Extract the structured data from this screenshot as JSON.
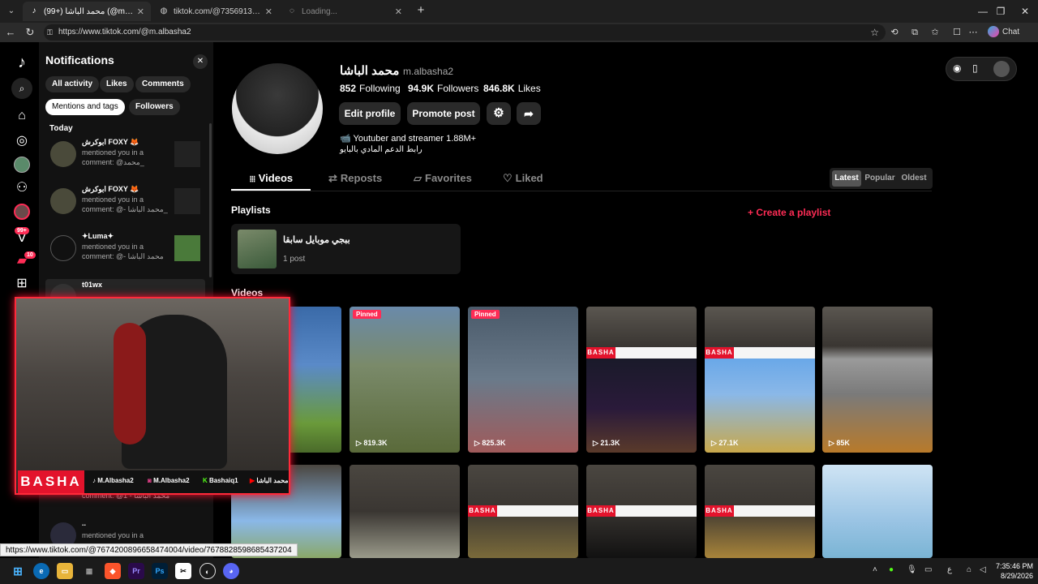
{
  "browser": {
    "tabs": [
      {
        "label": "(99+) محمد الباشا (@m.albasha2)",
        "active": true
      },
      {
        "label": "tiktok.com/@7356913511614333",
        "active": false
      },
      {
        "label": "Loading...",
        "active": false
      }
    ],
    "url": "https://www.tiktok.com/@m.albasha2",
    "chat_label": "Chat",
    "status_url": "https://www.tiktok.com/@7674200896658474004/video/7678828598685437204"
  },
  "rail": {
    "badge_inbox": "99+",
    "badge_messages": "10"
  },
  "notifications": {
    "title": "Notifications",
    "filters": [
      "All activity",
      "Likes",
      "Comments",
      "Mentions and tags",
      "Followers"
    ],
    "section": "Today",
    "items": [
      {
        "name": "ابوكرش FOXY 🦊",
        "line1": "mentioned you in a",
        "line2": "comment: @محمد_"
      },
      {
        "name": "ابوكرش FOXY 🦊",
        "line1": "mentioned you in a",
        "line2": "comment: @- محمد الباشا_"
      },
      {
        "name": "✦Luma✦",
        "line1": "mentioned you in a",
        "line2": "comment: @- محمد الباشا"
      },
      {
        "name": "t01wx",
        "line1": "",
        "line2": ""
      },
      {
        "name": "",
        "line1": "",
        "line2": "comment: @1 - محمد الباشا"
      },
      {
        "name": "..",
        "line1": "mentioned you in a",
        "line2": ""
      }
    ]
  },
  "profile": {
    "display_name": "محمد الباشا",
    "username": "m.albasha2",
    "following": "852",
    "following_label": "Following",
    "followers": "94.9K",
    "followers_label": "Followers",
    "likes": "846.8K",
    "likes_label": "Likes",
    "edit_label": "Edit profile",
    "promote_label": "Promote post",
    "bio_line1": "📹 Youtuber and streamer 1.88M+",
    "bio_line2": "رابط الدعم المادي بالبايو"
  },
  "content_tabs": [
    "Videos",
    "Reposts",
    "Favorites",
    "Liked"
  ],
  "sort_options": [
    "Latest",
    "Popular",
    "Oldest"
  ],
  "playlists": {
    "heading": "Playlists",
    "create_label": "Create a playlist",
    "item_title": "ببجي موبايل سابقا",
    "item_count": "1 post"
  },
  "videos": {
    "heading": "Videos",
    "row1": [
      {
        "views": "",
        "pinned": false
      },
      {
        "views": "819.3K",
        "pinned": true,
        "pin_label": "Pinned"
      },
      {
        "views": "825.3K",
        "pinned": true,
        "pin_label": "Pinned"
      },
      {
        "views": "21.3K",
        "pinned": false
      },
      {
        "views": "27.1K",
        "pinned": false
      },
      {
        "views": "85K",
        "pinned": false
      }
    ]
  },
  "webcam": {
    "brand": "BASHA",
    "socials": [
      "M.Albasha2",
      "M.Albasha2",
      "Bashaiq1",
      "محمد الباشا"
    ]
  },
  "clock": {
    "time": "7:35:46 PM",
    "date": "8/29/2026"
  },
  "tray_lang": "ع"
}
